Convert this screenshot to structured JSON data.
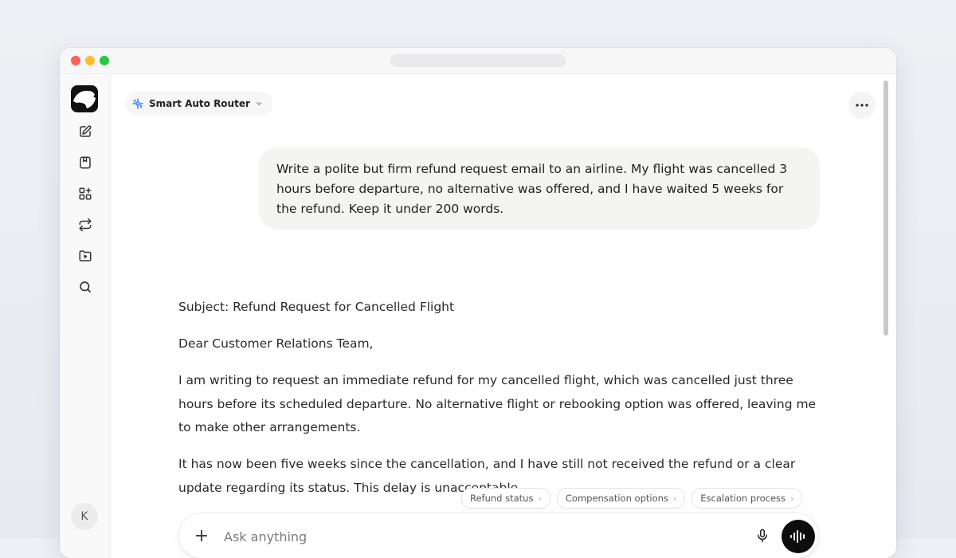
{
  "header": {
    "model_name": "Smart Auto Router",
    "model_icon": "router-icon",
    "more_icon": "more-icon"
  },
  "sidebar": {
    "items": [
      {
        "name": "new-chat",
        "icon": "edit-icon"
      },
      {
        "name": "library",
        "icon": "book-icon"
      },
      {
        "name": "apps",
        "icon": "apps-add-icon"
      },
      {
        "name": "switch",
        "icon": "repeat-icon"
      },
      {
        "name": "projects",
        "icon": "folder-icon"
      },
      {
        "name": "search",
        "icon": "search-icon"
      }
    ],
    "avatar_initial": "K"
  },
  "conversation": {
    "user_message": "Write a polite but firm refund request email to an airline. My flight was cancelled 3 hours before departure, no alternative was offered, and I have waited 5 weeks for the refund. Keep it under 200 words.",
    "assistant_paragraphs": [
      "Subject: Refund Request for Cancelled Flight",
      "Dear Customer Relations Team,",
      "I am writing to request an immediate refund for my cancelled flight, which was cancelled just three hours before its scheduled departure. No alternative flight or rebooking option was offered, leaving me to make other arrangements.",
      "It has now been five weeks since the cancellation, and I have still not received the refund or a clear update regarding its status. This delay is unacceptable."
    ]
  },
  "suggestions": [
    "Refund status",
    "Compensation options",
    "Escalation process"
  ],
  "composer": {
    "placeholder": "Ask anything",
    "plus_label": "+"
  },
  "colors": {
    "accent_router": "#3b82f6",
    "voice_button": "#0d0d0d",
    "user_bubble": "#f4f4f3"
  }
}
